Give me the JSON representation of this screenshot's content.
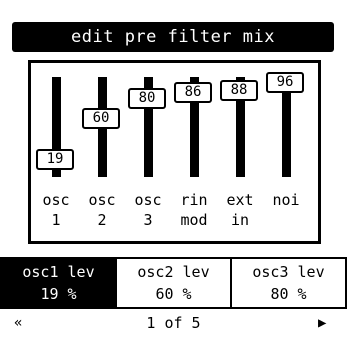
{
  "title": "edit pre filter mix",
  "channels": [
    {
      "value": "19",
      "level": 19,
      "label1": "osc",
      "label2": "1"
    },
    {
      "value": "60",
      "level": 60,
      "label1": "osc",
      "label2": "2"
    },
    {
      "value": "80",
      "level": 80,
      "label1": "osc",
      "label2": "3"
    },
    {
      "value": "86",
      "level": 86,
      "label1": "rin",
      "label2": "mod"
    },
    {
      "value": "88",
      "level": 88,
      "label1": "ext",
      "label2": "in"
    },
    {
      "value": "96",
      "level": 96,
      "label1": "noi",
      "label2": ""
    }
  ],
  "params": [
    {
      "name": "osc1 lev",
      "value": "19 %",
      "active": true
    },
    {
      "name": "osc2 lev",
      "value": "60 %",
      "active": false
    },
    {
      "name": "osc3 lev",
      "value": "80 %",
      "active": false
    }
  ],
  "pager": {
    "text": "1 of 5",
    "prev_icon": "double-chevron-left",
    "next_icon": "triangle-right"
  },
  "colors": {
    "foreground": "#000000",
    "background": "#ffffff"
  }
}
